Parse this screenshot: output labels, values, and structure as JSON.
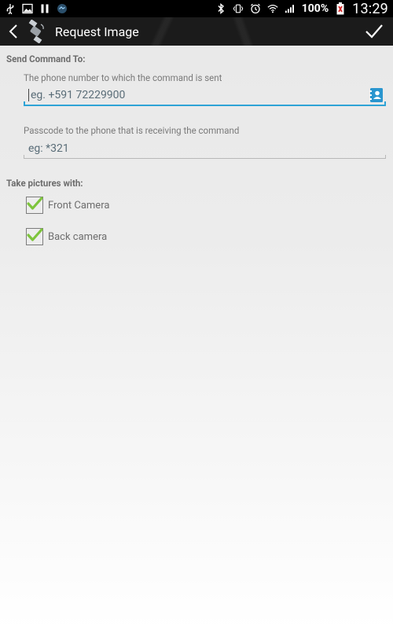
{
  "statusbar": {
    "battery_text": "100%",
    "time": "13:29",
    "icons_left": [
      "usb-icon",
      "image-icon",
      "pause-icon",
      "app-notification-icon"
    ],
    "icons_right": [
      "bluetooth-icon",
      "vibrate-icon",
      "alarm-icon",
      "wifi-icon",
      "signal-icon",
      "battery-icon"
    ]
  },
  "actionbar": {
    "title": "Request Image",
    "back_icon": "chevron-left-icon",
    "logo_icon": "satellite-icon",
    "confirm_icon": "check-icon"
  },
  "send_section": {
    "header": "Send Command To:",
    "phone_label": "The phone number to which the command is sent",
    "phone_placeholder": "eg. +591 72229900",
    "phone_value": "",
    "passcode_label": "Passcode to the phone that is receiving the command",
    "passcode_placeholder": "eg: *321",
    "passcode_value": ""
  },
  "camera_section": {
    "header": "Take pictures with:",
    "options": [
      {
        "label": "Front Camera",
        "checked": true
      },
      {
        "label": "Back camera",
        "checked": true
      }
    ]
  },
  "colors": {
    "accent": "#2ea3d6",
    "checkmark": "#7dc43c",
    "actionbar_bg": "#1b1b1b"
  }
}
